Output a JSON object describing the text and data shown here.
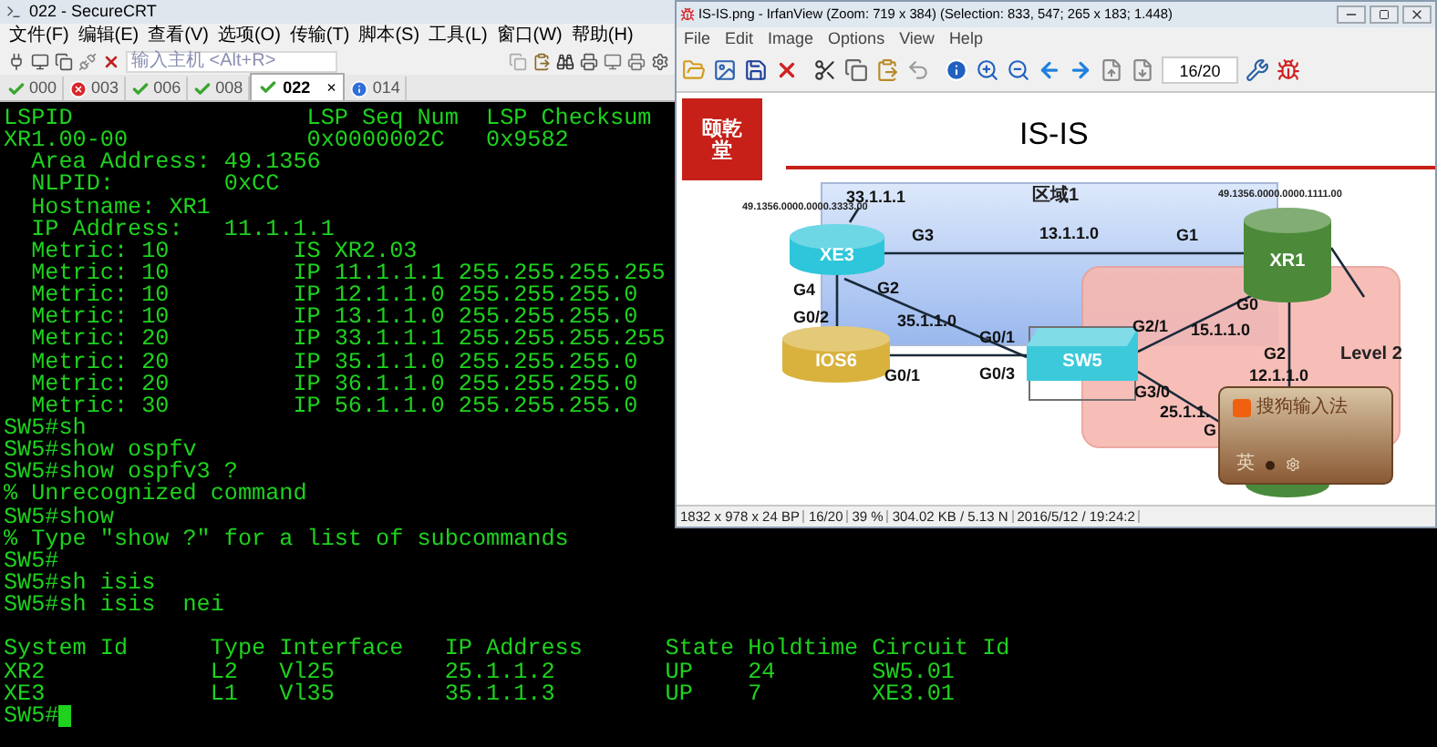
{
  "crt": {
    "title": "022 - SecureCRT",
    "menu": [
      "文件(F)",
      "编辑(E)",
      "查看(V)",
      "选项(O)",
      "传输(T)",
      "脚本(S)",
      "工具(L)",
      "窗口(W)",
      "帮助(H)"
    ],
    "host_field": {
      "placeholder": "输入主机 <Alt+R>"
    },
    "tabs": [
      {
        "label": "000",
        "kind": "ok",
        "selected": false
      },
      {
        "label": "003",
        "kind": "error",
        "selected": false
      },
      {
        "label": "006",
        "kind": "ok",
        "selected": false
      },
      {
        "label": "008",
        "kind": "ok",
        "selected": false
      },
      {
        "label": "022",
        "kind": "ok",
        "selected": true
      },
      {
        "label": "014",
        "kind": "info",
        "selected": false
      }
    ],
    "tab_close": "×",
    "terminal": [
      {
        "lines": [
          "LSPID                 LSP Seq Num  LSP Checksum",
          "XR1.00-00             0x0000002C   0x9582",
          "  Area Address: 49.1356",
          "  NLPID:        0xCC",
          "  Hostname: XR1",
          "  IP Address:   11.1.1.1",
          "  Metric: 10         IS XR2.03",
          "  Metric: 10         IP 11.1.1.1 255.255.255.255",
          "  Metric: 10         IP 12.1.1.0 255.255.255.0",
          "  Metric: 10         IP 13.1.1.0 255.255.255.0",
          "  Metric: 20         IP 33.1.1.1 255.255.255.255",
          "  Metric: 20         IP 35.1.1.0 255.255.255.0",
          "  Metric: 20         IP 36.1.1.0 255.255.255.0",
          "  Metric: 30         IP 56.1.1.0 255.255.255.0",
          "SW5#sh",
          "SW5#show ospfv",
          "SW5#show ospfv3 ?",
          "% Unrecognized command",
          "SW5#show",
          "% Type \"show ?\" for a list of subcommands",
          "SW5#",
          "SW5#sh isis",
          "SW5#sh isis  nei"
        ]
      },
      {
        "lines": [
          "System Id      Type Interface   IP Address      State Holdtime Circuit Id",
          "XR2            L2   Vl25        25.1.1.2        UP    24       SW5.01",
          "XE3            L1   Vl35        35.1.1.3        UP    7        XE3.01",
          "SW5#"
        ]
      }
    ]
  },
  "irfan": {
    "title": "IS-IS.png - IrfanView (Zoom: 719 x 384) (Selection: 833, 547; 265 x 183; 1.448)",
    "menu": [
      "File",
      "Edit",
      "Image",
      "Options",
      "View",
      "Help"
    ],
    "page_field": {
      "value": "16/20"
    },
    "slide": {
      "logo_text": "颐乾堂",
      "title": "IS-IS",
      "nodes": [
        {
          "label": "XE3",
          "kind": "router",
          "color": "#2ec6da"
        },
        {
          "label": "XR1",
          "kind": "router",
          "color": "#4c8a3a"
        },
        {
          "label": "IOS6",
          "kind": "router",
          "color": "#d9b23e"
        },
        {
          "label": "SW5",
          "kind": "switch",
          "color": "#3ccadb"
        },
        {
          "kind": "router",
          "color": "#4a8a3c"
        }
      ],
      "labels": [
        {
          "text": "33.1.1.1",
          "kind": "label"
        },
        {
          "text": "区域1",
          "kind": "area"
        },
        {
          "text": "49.1356.0000.0000.3333.00",
          "kind": "small"
        },
        {
          "text": "49.1356.0000.0000.1111.00",
          "kind": "small"
        },
        {
          "text": "G3",
          "kind": "label"
        },
        {
          "text": "13.1.1.0",
          "kind": "label"
        },
        {
          "text": "G1",
          "kind": "label"
        },
        {
          "text": "G4",
          "kind": "label"
        },
        {
          "text": "G2",
          "kind": "label"
        },
        {
          "text": "G0/2",
          "kind": "label"
        },
        {
          "text": "35.1.1.0",
          "kind": "label"
        },
        {
          "text": "G0/1",
          "kind": "label"
        },
        {
          "text": "G0/1",
          "kind": "label"
        },
        {
          "text": "G0/3",
          "kind": "label"
        },
        {
          "text": "G2/1",
          "kind": "label"
        },
        {
          "text": "15.1.1.0",
          "kind": "label"
        },
        {
          "text": "G0",
          "kind": "label"
        },
        {
          "text": "G2",
          "kind": "label"
        },
        {
          "text": "12.1.1.0",
          "kind": "label"
        },
        {
          "text": "G3/0",
          "kind": "label"
        },
        {
          "text": "25.1.1.",
          "kind": "label"
        },
        {
          "text": "G",
          "kind": "label"
        },
        {
          "text": "Level 2",
          "kind": "area"
        }
      ],
      "ime_popup": {
        "title": "搜狗输入法",
        "mode": "英"
      }
    },
    "status_bar": [
      "1832 x 978 x 24 BP",
      "16/20",
      "39 %",
      "304.02 KB / 5.13 N",
      "2016/5/12 / 19:24:2"
    ]
  }
}
